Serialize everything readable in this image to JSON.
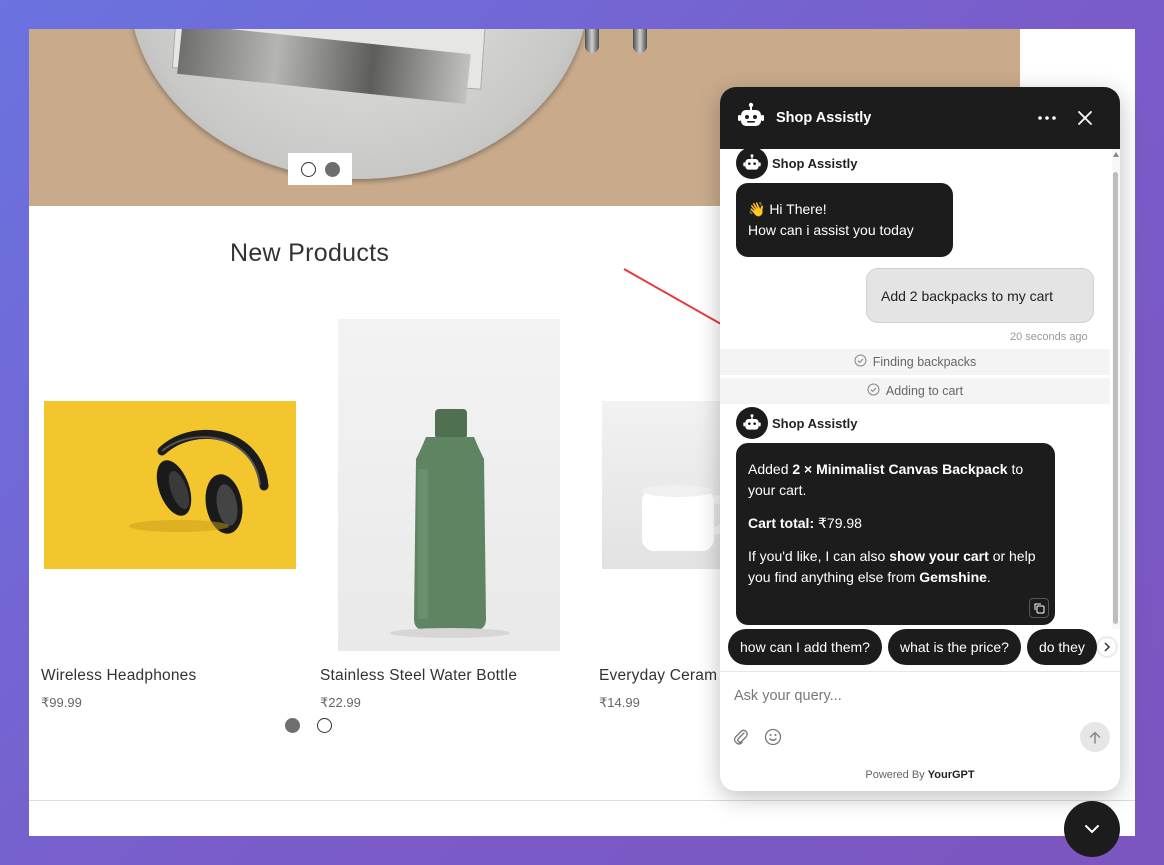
{
  "shop": {
    "section_title": "New Products",
    "products": [
      {
        "name": "Wireless Headphones",
        "price": "₹99.99"
      },
      {
        "name": "Stainless Steel Water Bottle",
        "price": "₹22.99"
      },
      {
        "name": "Everyday Ceram",
        "price": "₹14.99"
      }
    ]
  },
  "chat": {
    "header_title": "Shop Assistly",
    "bot_name": "Shop Assistly",
    "greeting_line1": "👋 Hi There!",
    "greeting_line2": "How can i assist you today",
    "user_message": "Add 2 backpacks to my cart",
    "timestamp": "20 seconds ago",
    "status_steps": [
      "Finding backpacks",
      "Adding to cart"
    ],
    "reply": {
      "added_prefix": "Added",
      "added_item": "2 × Minimalist Canvas Backpack",
      "added_suffix": "to your cart.",
      "total_label": "Cart total:",
      "total_value": "₹79.98",
      "offer_prefix": "If you'd like, I can also",
      "offer_bold": "show your cart",
      "offer_mid": "or help you find anything else from",
      "store_name": "Gemshine",
      "offer_end": "."
    },
    "suggestions": [
      "how can I add them?",
      "what is the price?",
      "do they"
    ],
    "input_placeholder": "Ask your query...",
    "powered_prefix": "Powered By",
    "powered_brand": "YourGPT"
  },
  "colors": {
    "dark": "#1c1c1c",
    "hero_bg": "#c9ab8c",
    "backdrop": "#6a73e0"
  },
  "icons": [
    "robot-icon",
    "more-icon",
    "close-icon",
    "check-circle-icon",
    "copy-icon",
    "chevron-right-icon",
    "paperclip-icon",
    "emoji-icon",
    "arrow-up-icon",
    "chevron-down-icon"
  ]
}
